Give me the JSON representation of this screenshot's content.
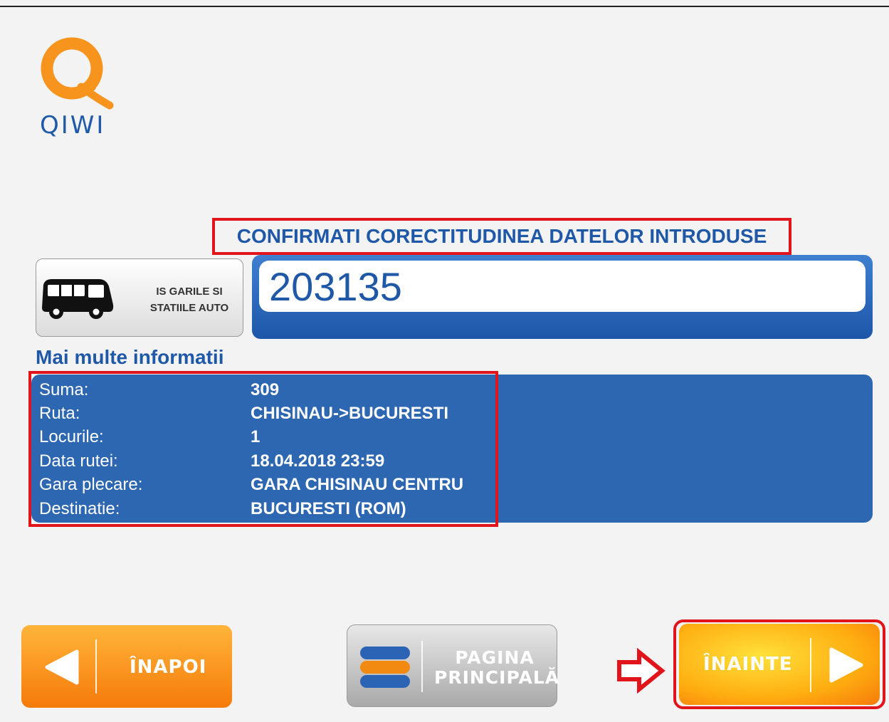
{
  "brand": {
    "logo_text": "QIWI",
    "accent_color": "#f7941d",
    "brand_blue": "#1f5aa8"
  },
  "confirm_title": "CONFIRMATI CORECTITUDINEA DATELOR INTRODUSE",
  "provider": {
    "name_line1": "IS GARILE SI",
    "name_line2": "STATIILE AUTO",
    "icon": "bus-icon"
  },
  "account": {
    "value": "203135"
  },
  "more_info": {
    "title": "Mai multe informatii",
    "rows": [
      {
        "label": "Suma:",
        "value": "309"
      },
      {
        "label": "Ruta:",
        "value": "CHISINAU->BUCURESTI"
      },
      {
        "label": "Locurile:",
        "value": "1"
      },
      {
        "label": "Data rutei:",
        "value": "18.04.2018 23:59"
      },
      {
        "label": "Gara plecare:",
        "value": "GARA CHISINAU CENTRU"
      },
      {
        "label": "Destinatie:",
        "value": "BUCURESTI (ROM)"
      }
    ]
  },
  "buttons": {
    "back": {
      "label": "ÎNAPOI",
      "icon": "left-triangle-icon"
    },
    "home": {
      "label_line1": "PAGINA",
      "label_line2": "PRINCIPALĂ",
      "icon": "stack-icon"
    },
    "next": {
      "label": "ÎNAINTE",
      "icon": "right-triangle-icon"
    }
  },
  "annotations": {
    "highlight_color": "#e1141b",
    "pointer_icon": "right-arrow-outline-icon"
  }
}
